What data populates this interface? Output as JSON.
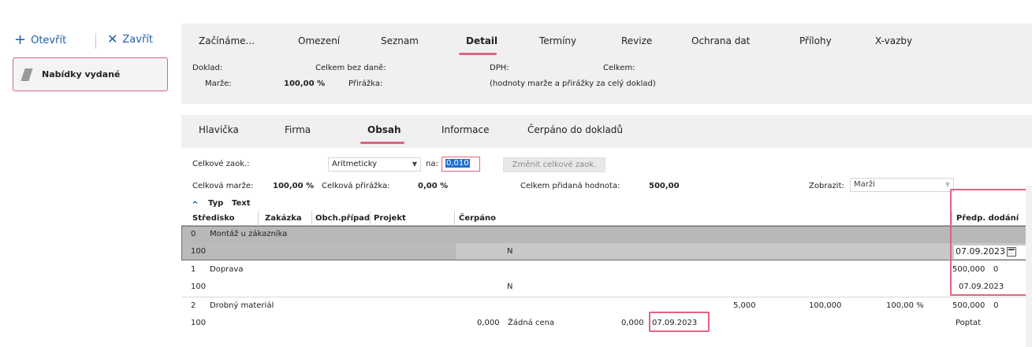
{
  "toolbar": {
    "open_label": "Otevřít",
    "close_label": "Zavřít",
    "open_icon": "plus-icon",
    "close_icon": "close-icon"
  },
  "left_panel": {
    "item_label": "Nabídky vydané"
  },
  "main_tabs": [
    {
      "pre": "Začínáme",
      "acc": "",
      "post": "...",
      "acc_after": true
    },
    {
      "pre": "",
      "acc": "O",
      "post": "mezení"
    },
    {
      "pre": "Se",
      "acc": "z",
      "post": "nam"
    },
    {
      "pre": "",
      "acc": "D",
      "post": "etail",
      "active": true
    },
    {
      "pre": "",
      "acc": "T",
      "post": "ermíny"
    },
    {
      "pre": "",
      "acc": "R",
      "post": "evize"
    },
    {
      "pre": "Ochrana dat",
      "acc": "",
      "post": ""
    },
    {
      "pre": "Přílo",
      "acc": "h",
      "post": "y"
    },
    {
      "pre": "",
      "acc": "X",
      "post": "-vazby"
    }
  ],
  "main_tabs_full": [
    "Začínáme...",
    "Omezení",
    "Seznam",
    "Detail",
    "Termíny",
    "Revize",
    "Ochrana dat",
    "Přílohy",
    "X-vazby"
  ],
  "info": {
    "doklad": "Doklad:",
    "celkem_bez_dane": "Celkem bez daně:",
    "dph": "DPH:",
    "celkem": "Celkem:",
    "marze_label": "Marže:",
    "marze_value": "100,00 %",
    "prirazka_label": "Přirážka:",
    "note": "(hodnoty marže a přirážky za celý doklad)"
  },
  "sub_tabs": [
    "Hlavička",
    "Firma",
    "Obsah",
    "Informace",
    "Čerpáno do dokladů"
  ],
  "sub_tabs_active": "Obsah",
  "filters": {
    "celkove_zaok_label": "Celkové zaok.:",
    "method": "Aritmeticky",
    "na_label": "na:",
    "na_value": "0,010",
    "change_button": "Změnit celkové zaok.",
    "celkova_marze_label": "Celková marže:",
    "celkova_marze_value": "100,00 %",
    "celkova_prirazka_label": "Celková přirážka:",
    "celkova_prirazka_value": "0,00 %",
    "pridana_hodnota_label": "Celkem přidaná hodnota:",
    "pridana_hodnota_value": "500,00",
    "zobrazit_label": "Zobrazit:",
    "zobrazit_value": "Marži"
  },
  "grid": {
    "header1": [
      "Typ",
      "Text"
    ],
    "header2": [
      "Středisko",
      "Zakázka",
      "Obch.případ",
      "Projekt",
      "Čerpáno",
      "Předp. dodání"
    ],
    "rows": [
      {
        "typ": "0",
        "text": "Montáž u zákazníka",
        "stredisko": "100",
        "cerpano": "N",
        "date": "07.09.2023"
      },
      {
        "typ": "1",
        "text": "Doprava",
        "stredisko": "100",
        "cerpano": "N",
        "value": "500,000",
        "zero": "0",
        "date": "07.09.2023"
      },
      {
        "typ": "2",
        "text": "Drobný materiál",
        "stredisko": "100",
        "mnozstvi": "5,000",
        "cena": "100,000",
        "procent": "100,00 %",
        "value": "500,000",
        "zero": "0",
        "cena_left": "0,000",
        "cena_typ": "Žádná cena",
        "cena_right": "0,000",
        "date": "07.09.2023",
        "stav": "Poptat"
      }
    ]
  },
  "colors": {
    "accent": "#e0637f",
    "link": "#1f5ea8",
    "selected_row": "#b8b8b8"
  }
}
